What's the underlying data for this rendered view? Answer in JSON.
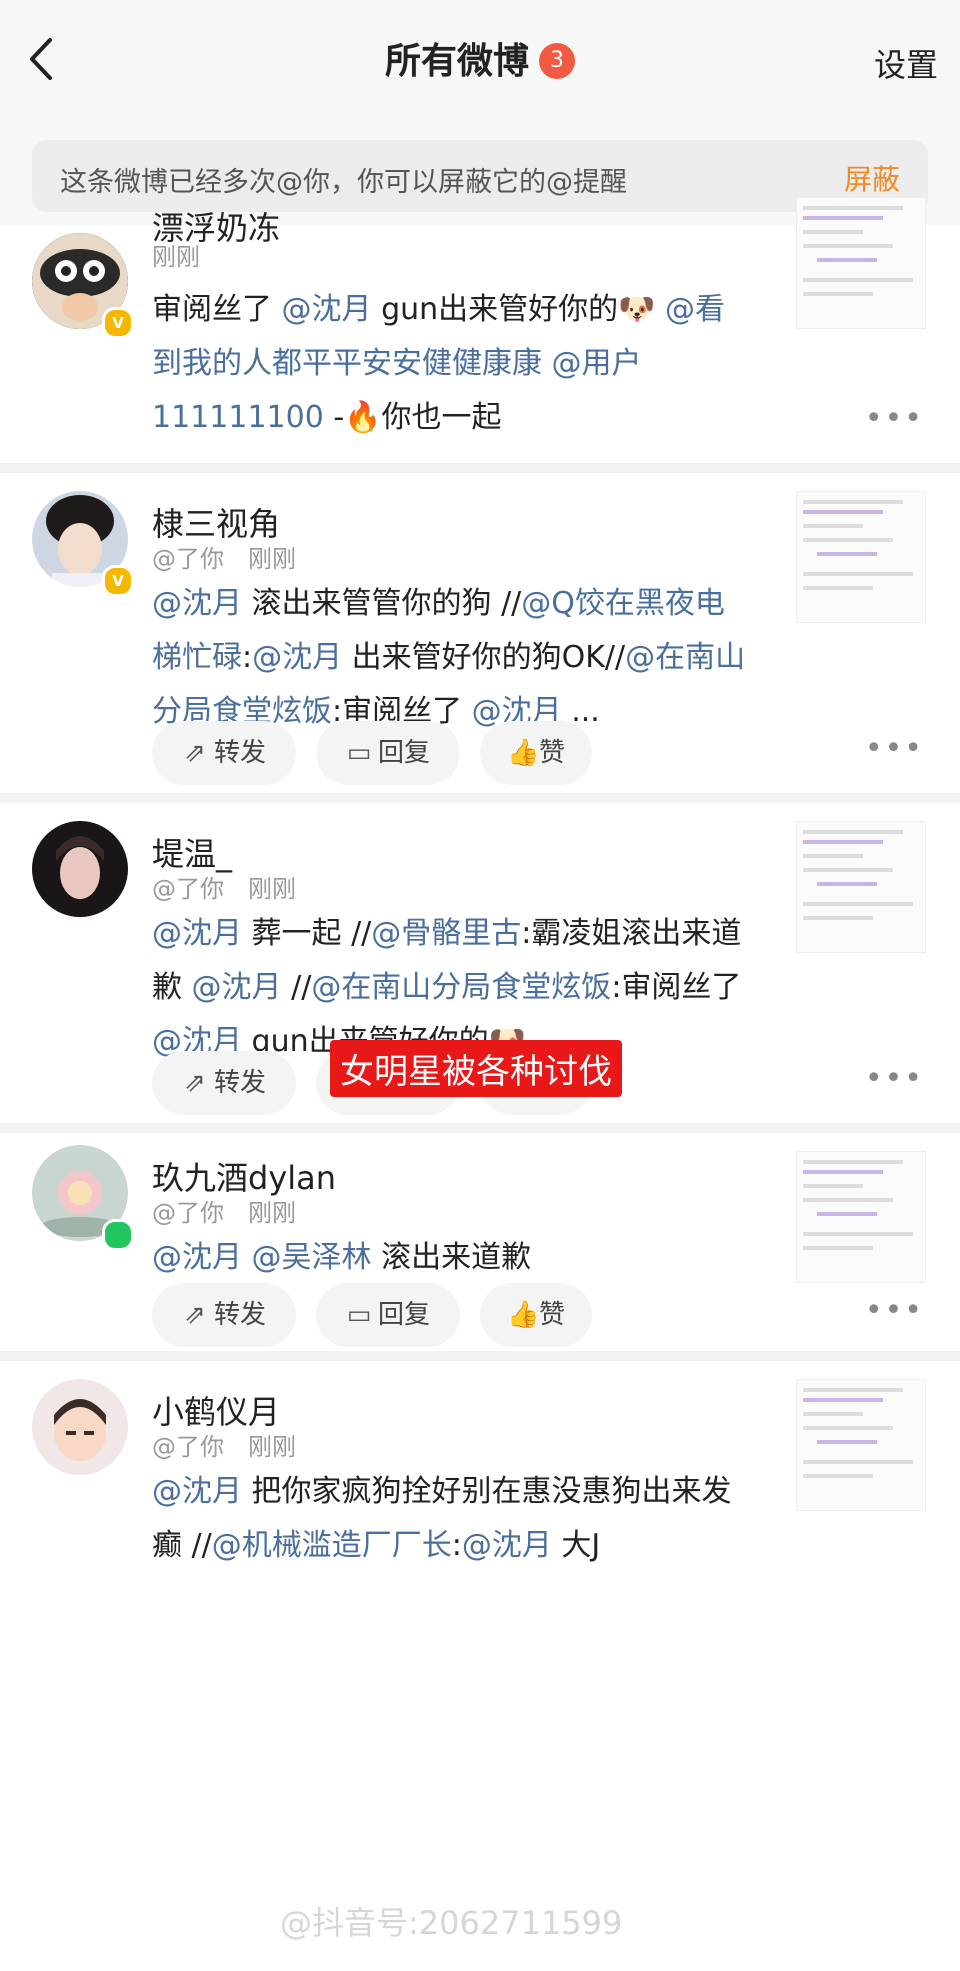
{
  "header": {
    "title": "所有微博",
    "badge": "3",
    "settings": "设置"
  },
  "notice": {
    "text": "这条微博已经多次@你，你可以屏蔽它的@提醒",
    "action": "屏蔽"
  },
  "actions": {
    "repost": "转发",
    "reply": "回复",
    "like": "赞"
  },
  "posts": [
    {
      "name": "漂浮奶冻",
      "meta1": "刚刚",
      "body": [
        {
          "t": "审阅丝了 "
        },
        {
          "t": "@沈月",
          "at": true
        },
        {
          "t": " gun出来管好你的🐶 "
        },
        {
          "t": "@",
          "at": true
        },
        {
          "t": "看到我的人都平平安安健健康康 ",
          "at": true
        },
        {
          "t": "@用户1",
          "at": true
        },
        {
          "t": "11111100",
          "at": true
        },
        {
          "t": " -🔥你也一起"
        }
      ]
    },
    {
      "name": "棣三视角",
      "meta1": "@了你",
      "meta2": "刚刚",
      "body": [
        {
          "t": "@沈月",
          "at": true
        },
        {
          "t": " 滚出来管管你的狗 //"
        },
        {
          "t": "@Q饺在黑夜电梯忙碌",
          "at": true
        },
        {
          "t": ":"
        },
        {
          "t": "@沈月",
          "at": true
        },
        {
          "t": " 出来管好你的狗OK//"
        },
        {
          "t": "@在南山分局食堂炫饭",
          "at": true
        },
        {
          "t": ":审阅丝了 "
        },
        {
          "t": "@沈月",
          "at": true
        },
        {
          "t": " ..."
        }
      ]
    },
    {
      "name": "堤温_",
      "meta1": "@了你",
      "meta2": "刚刚",
      "body": [
        {
          "t": "@沈月",
          "at": true
        },
        {
          "t": " 葬一起 //"
        },
        {
          "t": "@骨骼里古",
          "at": true
        },
        {
          "t": ":霸凌姐滚出来道歉 "
        },
        {
          "t": "@沈月",
          "at": true
        },
        {
          "t": " //"
        },
        {
          "t": "@在南山分局食堂炫饭",
          "at": true
        },
        {
          "t": ":审阅丝了 "
        },
        {
          "t": "@沈月",
          "at": true
        },
        {
          "t": " gun出来管好你的🐶 ..."
        }
      ]
    },
    {
      "name": "玖九酒dylan",
      "meta1": "@了你",
      "meta2": "刚刚",
      "body": [
        {
          "t": "@沈月",
          "at": true
        },
        {
          "t": " "
        },
        {
          "t": "@吴泽林",
          "at": true
        },
        {
          "t": " 滚出来道歉"
        }
      ]
    },
    {
      "name": "小鹤仪月",
      "meta1": "@了你",
      "meta2": "刚刚",
      "body": [
        {
          "t": "@沈月",
          "at": true
        },
        {
          "t": " 把你家疯狗拴好别在惠没惠狗出来发癫 //"
        },
        {
          "t": "@机械滥造厂厂长",
          "at": true
        },
        {
          "t": ":"
        },
        {
          "t": "@沈月",
          "at": true
        },
        {
          "t": " 大J"
        }
      ]
    }
  ],
  "overlay_label": "女明星被各种讨伐",
  "watermark": "@抖音号:2062711599"
}
